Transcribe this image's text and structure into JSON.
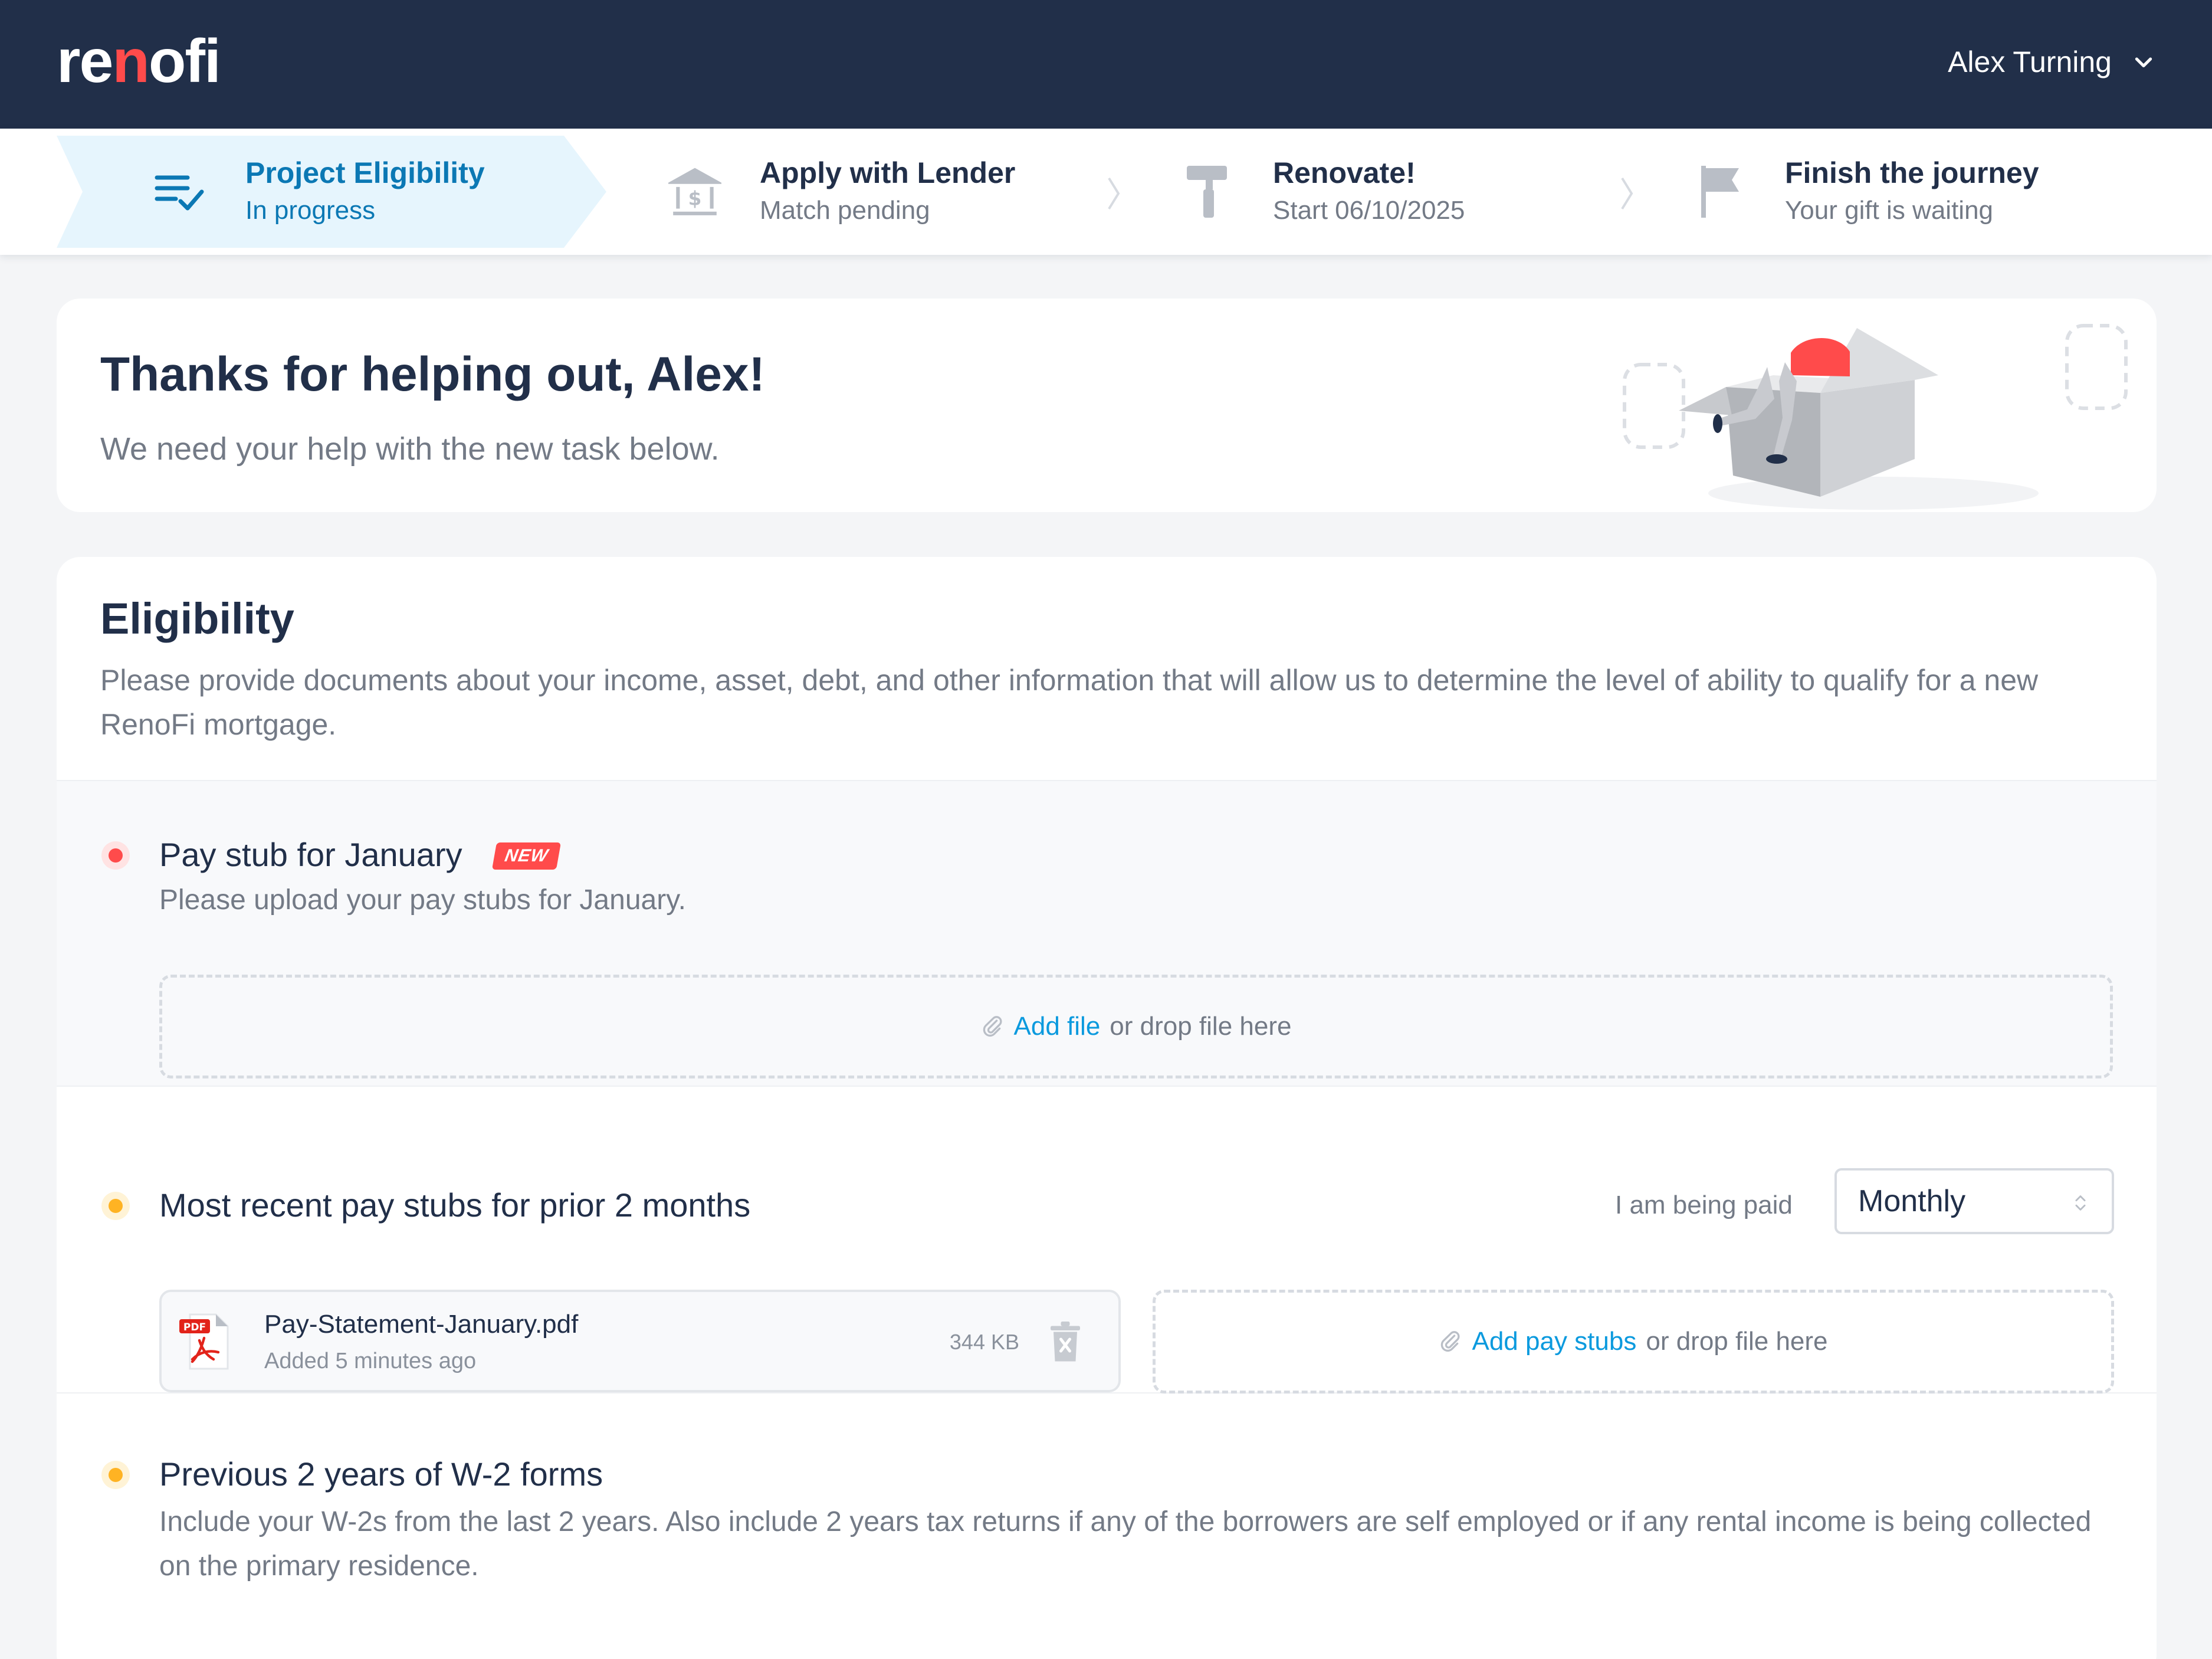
{
  "header": {
    "logo_pre": "re",
    "logo_accent": "n",
    "logo_post": "ofi",
    "user_name": "Alex Turning",
    "user_menu_icon": "chevron-down-icon"
  },
  "steps": [
    {
      "title": "Project Eligibility",
      "subtitle": "In progress",
      "icon": "checklist-icon",
      "active": true
    },
    {
      "title": "Apply with Lender",
      "subtitle": "Match pending",
      "icon": "bank-icon",
      "active": false
    },
    {
      "title": "Renovate!",
      "subtitle": "Start 06/10/2025",
      "icon": "paint-roller-icon",
      "active": false
    },
    {
      "title": "Finish the journey",
      "subtitle": "Your gift is waiting",
      "icon": "flag-icon",
      "active": false
    }
  ],
  "welcome": {
    "title": "Thanks for helping out, Alex!",
    "subtitle": "We need your help with the new task below."
  },
  "eligibility": {
    "title": "Eligibility",
    "description": "Please provide documents about your income, asset, debt, and other information that will allow us to determine the level of ability to qualify for a new RenoFi mortgage.",
    "tasks": [
      {
        "title": "Pay stub for January",
        "badge": "NEW",
        "description": "Please upload your pay stubs for January.",
        "upload_link": "Add file",
        "upload_suffix": "or drop file here",
        "status_color": "#ff4b4b"
      },
      {
        "title": "Most recent pay stubs for prior 2 months",
        "frequency_label": "I am being paid",
        "frequency_value": "Monthly",
        "file": {
          "name": "Pay-Statement-January.pdf",
          "added": "Added 5 minutes ago",
          "size": "344 KB",
          "type_label": "PDF"
        },
        "upload_link": "Add pay stubs",
        "upload_suffix": "or drop file here",
        "status_color": "#ffb323"
      },
      {
        "title": "Previous 2 years of W-2 forms",
        "description": "Include your W-2s from the last 2 years. Also include 2 years tax returns if any of the borrowers are self employed or if any rental income is being collected on the primary residence.",
        "status_color": "#ffb323"
      }
    ]
  },
  "colors": {
    "navy": "#212f49",
    "accent_red": "#ff4b4b",
    "link_blue": "#0b9ade",
    "active_step_blue": "#0b78b4",
    "active_step_bg": "#e6f5fd",
    "warning_orange": "#ffb323"
  }
}
